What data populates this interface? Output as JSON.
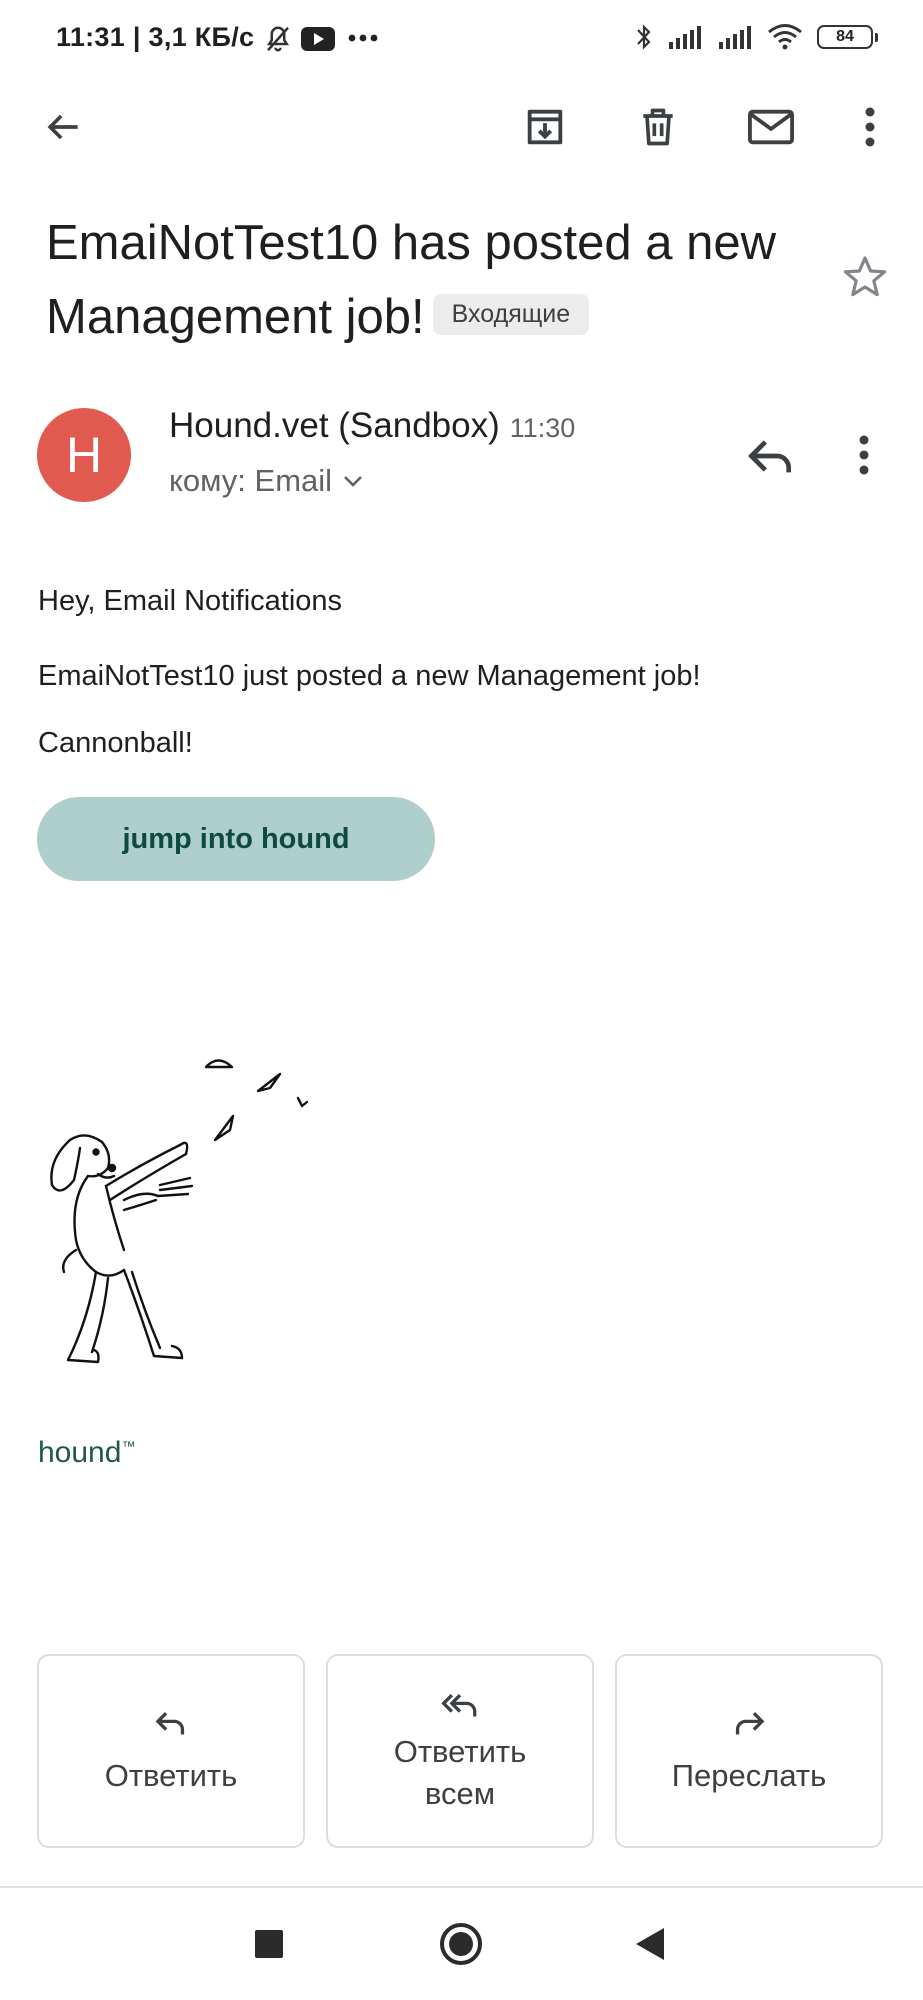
{
  "status_bar": {
    "time_speed": "11:31 | 3,1 КБ/с",
    "battery": "84"
  },
  "subject": {
    "text": "EmaiNotTest10 has posted a new Management job!",
    "label": "Входящие"
  },
  "sender": {
    "avatar_letter": "H",
    "name": "Hound.vet (Sandbox)",
    "time": "11:30",
    "recipient": "кому: Email"
  },
  "body": {
    "greeting": "Hey, Email Notifications",
    "message": "EmaiNotTest10 just posted a new Management job!",
    "exclaim": "Cannonball!",
    "cta": "jump into hound",
    "brand": "hound",
    "brand_mark": "™"
  },
  "actions": {
    "reply": "Ответить",
    "reply_all": "Ответить всем",
    "forward": "Переслать"
  },
  "colors": {
    "avatar": "#e05a4f",
    "cta_bg": "#afcfcc",
    "cta_text": "#0e4b3e",
    "brand": "#1e5a47"
  }
}
